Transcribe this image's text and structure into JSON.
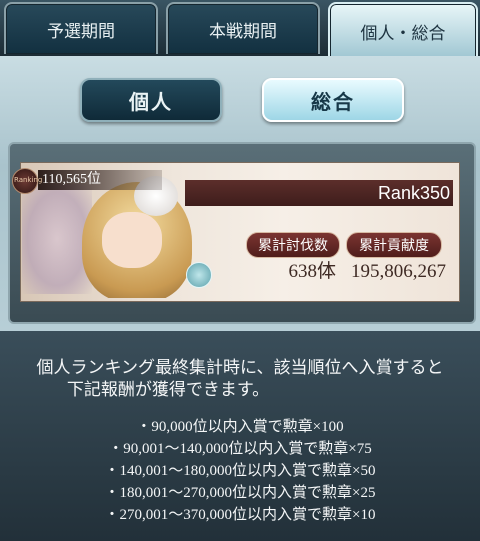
{
  "tabs": [
    "予選期間",
    "本戦期間",
    "個人・総合"
  ],
  "segments": {
    "individual": "個人",
    "overall": "総合"
  },
  "card": {
    "badge_text": "Ranking",
    "placement": "110,565位",
    "rank": "Rank350",
    "kills_label": "累計討伐数",
    "contrib_label": "累計貢献度",
    "kills_value": "638体",
    "contrib_value": "195,806,267"
  },
  "info": {
    "line1": "個人ランキング最終集計時に、該当順位へ入賞すると",
    "line2": "下記報酬が獲得できます。",
    "rewards": [
      "・90,000位以内入賞で勲章×100",
      "・90,001～140,000位以内入賞で勲章×75",
      "・140,001～180,000位以内入賞で勲章×50",
      "・180,001～270,000位以内入賞で勲章×25",
      "・270,001～370,000位以内入賞で勲章×10"
    ]
  }
}
